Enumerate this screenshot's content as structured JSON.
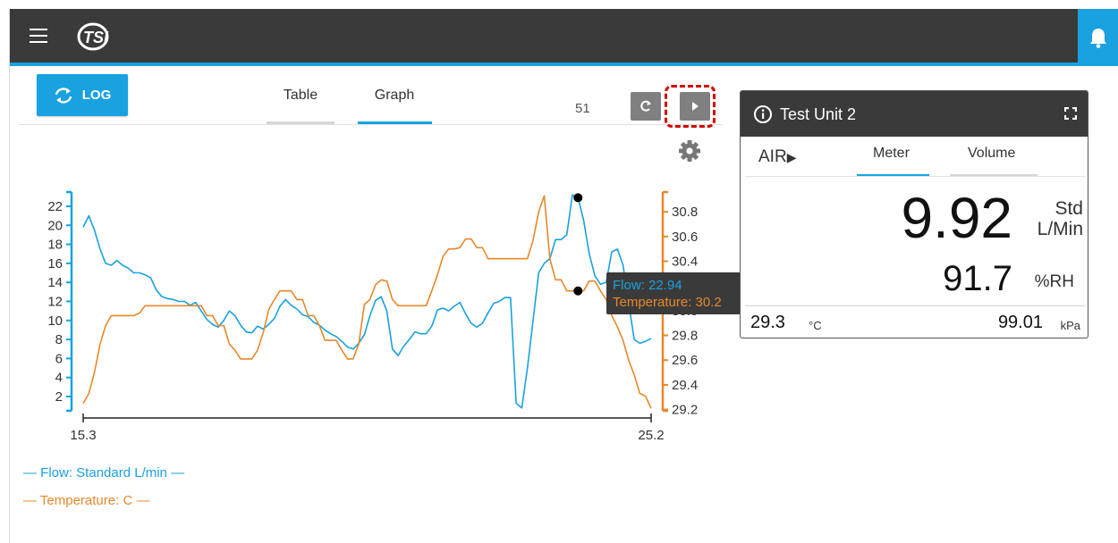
{
  "header": {
    "menu_icon": "hamburger-icon",
    "logo_text": "TSI",
    "bell_icon": "bell-icon"
  },
  "toolbar": {
    "log_label": "LOG",
    "log_icon": "sync-icon",
    "tabs": [
      {
        "label": "Table",
        "active": false
      },
      {
        "label": "Graph",
        "active": true
      }
    ],
    "count": "51",
    "refresh_icon": "refresh-icon",
    "play_icon": "play-icon",
    "settings_icon": "gear-icon"
  },
  "chart_data": {
    "type": "line",
    "title": "",
    "x_range": [
      15.3,
      25.2
    ],
    "x_tick_labels": [
      "15.3",
      "25.2"
    ],
    "y_left_ticks": [
      2,
      4,
      6,
      8,
      10,
      12,
      14,
      16,
      18,
      20,
      22
    ],
    "y_right_ticks": [
      29.2,
      29.4,
      29.6,
      29.8,
      30.0,
      30.2,
      30.4,
      30.6,
      30.8
    ],
    "y_left_range": [
      0.5,
      23.5
    ],
    "y_right_range": [
      29.19,
      30.96
    ],
    "series": [
      {
        "name": "Flow: Standard L/min",
        "axis": "left",
        "color": "#1aa1df",
        "values": [
          19.8,
          21.0,
          19.5,
          17.5,
          16.0,
          15.8,
          16.3,
          15.8,
          15.5,
          15.0,
          15.0,
          14.8,
          14.5,
          13.2,
          12.5,
          12.3,
          12.2,
          12.0,
          12.0,
          11.6,
          11.9,
          11.0,
          10.1,
          9.6,
          9.3,
          10.0,
          11.0,
          10.5,
          9.5,
          8.8,
          8.7,
          9.4,
          9.1,
          9.6,
          10.2,
          11.5,
          12.2,
          11.6,
          11.2,
          10.6,
          10.4,
          9.8,
          9.5,
          9.0,
          8.6,
          8.3,
          7.8,
          7.2,
          7.0,
          7.6,
          8.5,
          10.5,
          12.1,
          12.5,
          11.0,
          7.0,
          6.3,
          7.3,
          8.0,
          8.8,
          8.6,
          8.6,
          9.4,
          11.1,
          11.3,
          11.0,
          11.5,
          11.9,
          10.7,
          9.7,
          9.3,
          9.7,
          10.8,
          11.8,
          12.0,
          12.4,
          12.4,
          1.3,
          0.8,
          5.0,
          10.0,
          15.0,
          16.0,
          16.5,
          18.5,
          18.5,
          19.0,
          23.2,
          22.9,
          20.5,
          17.0,
          14.7,
          13.8,
          14.0,
          17.2,
          17.5,
          15.8,
          11.8,
          8.0,
          7.6,
          7.8,
          8.1
        ]
      },
      {
        "name": "Temperature: C",
        "axis": "right",
        "color": "#e8882a",
        "values": [
          29.25,
          29.33,
          29.5,
          29.73,
          29.88,
          29.96,
          29.96,
          29.96,
          29.96,
          29.96,
          29.98,
          30.04,
          30.04,
          30.04,
          30.04,
          30.04,
          30.04,
          30.04,
          30.04,
          30.04,
          30.04,
          30.04,
          29.96,
          29.96,
          29.88,
          29.88,
          29.73,
          29.68,
          29.61,
          29.61,
          29.61,
          29.68,
          29.82,
          30.01,
          30.09,
          30.16,
          30.16,
          30.16,
          30.09,
          30.09,
          29.96,
          29.96,
          29.88,
          29.76,
          29.76,
          29.76,
          29.68,
          29.61,
          29.61,
          29.73,
          30.05,
          30.09,
          30.21,
          30.25,
          30.24,
          30.09,
          30.04,
          30.04,
          30.04,
          30.04,
          30.04,
          30.04,
          30.16,
          30.29,
          30.44,
          30.5,
          30.5,
          30.51,
          30.58,
          30.58,
          30.51,
          30.51,
          30.42,
          30.42,
          30.42,
          30.42,
          30.42,
          30.42,
          30.42,
          30.42,
          30.57,
          30.8,
          30.93,
          30.42,
          30.25,
          30.25,
          30.16,
          30.16,
          30.16,
          30.16,
          30.24,
          30.24,
          30.16,
          30.09,
          29.96,
          29.87,
          29.76,
          29.6,
          29.48,
          29.33,
          29.31,
          29.21
        ]
      }
    ],
    "markers": [
      {
        "x_index": 88
      }
    ],
    "tooltip": {
      "flow_label": "Flow: 22.94",
      "temp_label": "Temperature: 30.2"
    },
    "legend": [
      "Flow: Standard L/min",
      "Temperature: C"
    ],
    "legend_position": "bottom-left",
    "grid": false
  },
  "legend": {
    "flow": "Flow: Standard L/min",
    "temp": "Temperature: C"
  },
  "colors": {
    "accent": "#1aa1df",
    "temperature": "#e8882a",
    "header": "#3a3a3a"
  },
  "card": {
    "title": "Test Unit 2",
    "info_icon": "info-icon",
    "expand_icon": "expand-icon",
    "channel": "AIR",
    "tabs": [
      {
        "label": "Meter",
        "active": true
      },
      {
        "label": "Volume",
        "active": false
      }
    ],
    "primary_value": "9.92",
    "primary_unit_line1": "Std",
    "primary_unit_line2": "L/Min",
    "secondary_value": "91.7",
    "secondary_unit": "%RH",
    "temp_value": "29.3",
    "temp_unit": "°C",
    "pressure_value": "99.01",
    "pressure_unit": "kPa"
  }
}
